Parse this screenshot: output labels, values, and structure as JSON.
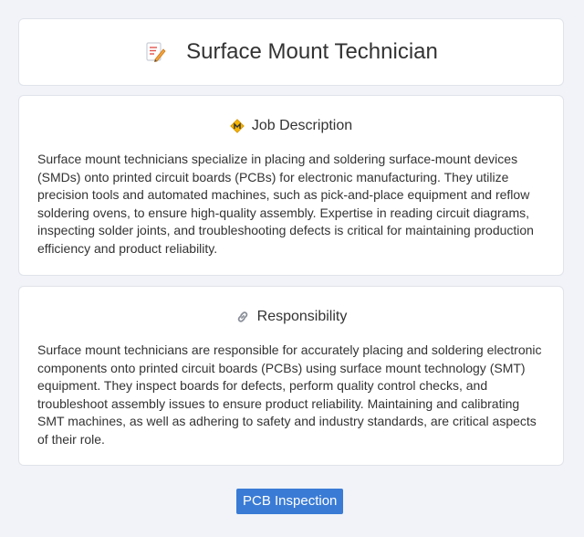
{
  "header": {
    "title": "Surface Mount Technician",
    "icon": "memo-icon"
  },
  "job_description": {
    "icon": "warning-diamond-icon",
    "title": "Job Description",
    "text": "Surface mount technicians specialize in placing and soldering surface-mount devices (SMDs) onto printed circuit boards (PCBs) for electronic manufacturing. They utilize precision tools and automated machines, such as pick-and-place equipment and reflow soldering ovens, to ensure high-quality assembly. Expertise in reading circuit diagrams, inspecting solder joints, and troubleshooting defects is critical for maintaining production efficiency and product reliability."
  },
  "responsibility": {
    "icon": "link-icon",
    "title": "Responsibility",
    "text": "Surface mount technicians are responsible for accurately placing and soldering electronic components onto printed circuit boards (PCBs) using surface mount technology (SMT) equipment. They inspect boards for defects, perform quality control checks, and troubleshoot assembly issues to ensure product reliability. Maintaining and calibrating SMT machines, as well as adhering to safety and industry standards, are critical aspects of their role."
  },
  "tags": [
    {
      "label": "PCB Inspection",
      "color": "#3a7bd5"
    }
  ],
  "colors": {
    "background": "#f1f3f8",
    "card": "#ffffff",
    "text": "#333333",
    "accent": "#3a7bd5"
  }
}
